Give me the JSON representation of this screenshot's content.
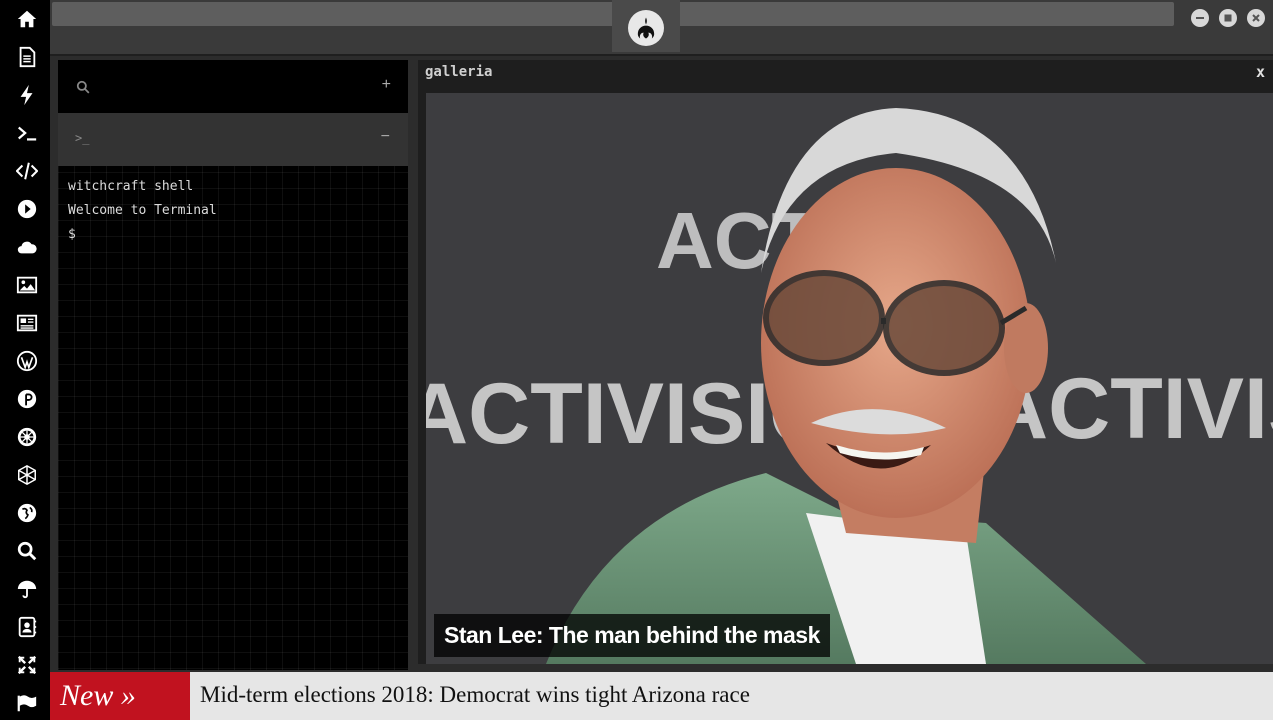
{
  "sidebar": {
    "icons": [
      "home-icon",
      "document-icon",
      "bolt-icon",
      "terminal-icon",
      "code-icon",
      "play-icon",
      "cloud-icon",
      "image-icon",
      "newspaper-icon",
      "wordpress-icon",
      "pinterest-icon",
      "galactic-empire-icon",
      "hexagon-network-icon",
      "globe-icon",
      "search-icon",
      "umbrella-icon",
      "address-book-icon",
      "expand-icon",
      "flag-icon"
    ]
  },
  "window_controls": [
    "minimize-icon",
    "maximize-icon",
    "close-icon"
  ],
  "terminal": {
    "search_add": "+",
    "tab_prompt": ">_",
    "tab_collapse": "−",
    "lines": [
      "witchcraft shell",
      "Welcome to Terminal",
      "$"
    ]
  },
  "gallery": {
    "title": "galleria",
    "close": "x",
    "caption": "Stan Lee: The man behind the mask",
    "backdrop_text": [
      "ACTIVISION",
      "ACTIVISION",
      "ACTI"
    ]
  },
  "ticker": {
    "badge": "New »",
    "headline": "Mid-term elections 2018: Democrat wins tight Arizona race"
  },
  "colors": {
    "sidebar_bg": "#000000",
    "ticker_badge": "#c1121f",
    "photo_jacket": "#6f9a7c"
  }
}
